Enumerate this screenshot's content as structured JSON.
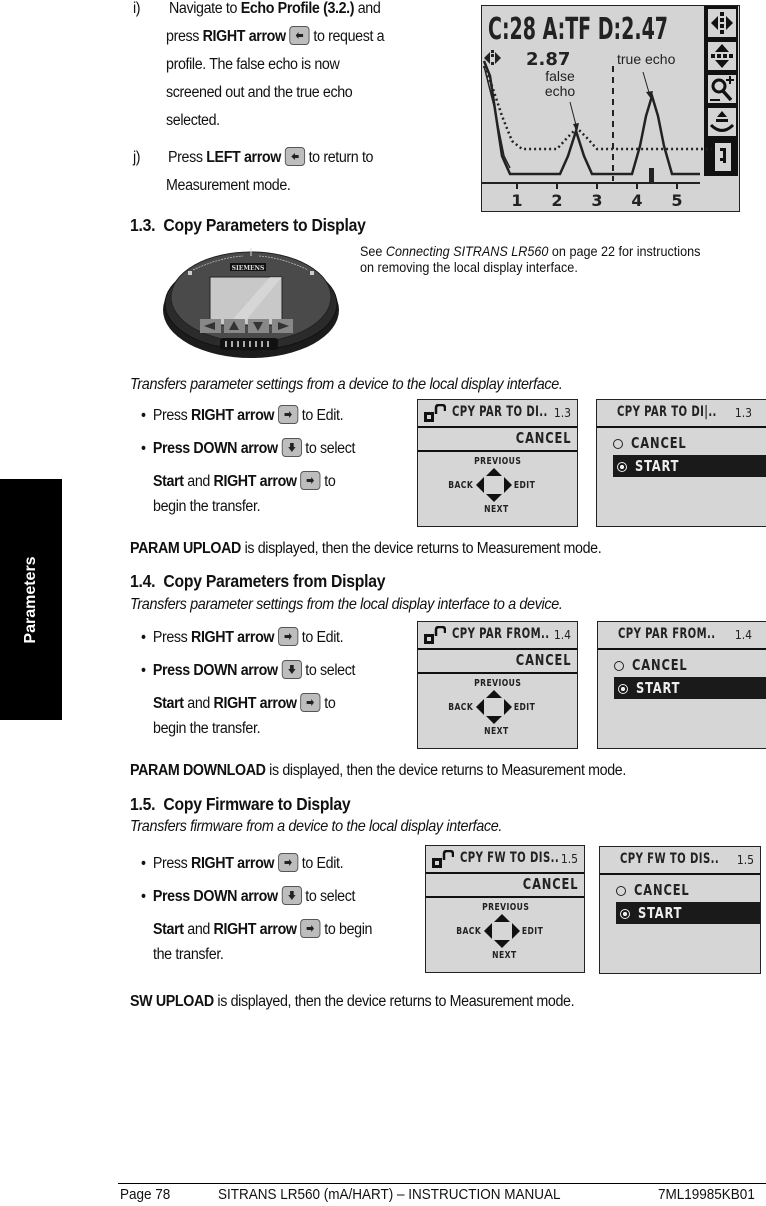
{
  "side_tab": {
    "label": "Parameters"
  },
  "steps": {
    "i": {
      "marker": "i)",
      "line1_pre": "Navigate to ",
      "line1_bold": "Echo Profile (3.2.)",
      "line1_post": " and",
      "line2_pre": "press ",
      "line2_bold": "RIGHT arrow",
      "line2_post": "to request a",
      "line3": "profile. The false echo is now",
      "line4": "screened out and the true echo",
      "line5": "selected."
    },
    "j": {
      "marker": "j)",
      "line1_pre": "Press ",
      "line1_bold": "LEFT arrow",
      "line1_post": "to return to",
      "line2": "Measurement mode."
    }
  },
  "profile_display": {
    "header": "C:28   A:TF D:2.47",
    "cursor_value": "2.87",
    "label_false_echo": "false echo",
    "label_false_line1": "false",
    "label_false_line2": "echo",
    "label_true_echo": "true echo",
    "x_ticks": [
      "1",
      "2",
      "3",
      "4",
      "5"
    ],
    "side_icons": [
      "horizontal-pan-icon",
      "vertical-pan-icon",
      "zoom-in-icon",
      "measure-icon",
      "exit-icon"
    ]
  },
  "sections": [
    {
      "number": "1.3.",
      "title": "Copy Parameters to Display",
      "note_pre": "See ",
      "note_italic": "Connecting SITRANS LR560",
      "note_post_line1": " on page 22 for instructions",
      "note_line2": "on removing the local display interface.",
      "description": "Transfers parameter settings from a device to the local display interface.",
      "bullets": {
        "b1_pre": "Press ",
        "b1_bold": "RIGHT arrow",
        "b1_post": "to Edit.",
        "b2_bold": "Press DOWN arrow",
        "b2_post": "to select",
        "b3_bold1": "Start",
        "b3_mid": " and ",
        "b3_bold2": "RIGHT arrow",
        "b3_post": "to",
        "b4": "begin the transfer."
      },
      "lcd_edit": {
        "title": "CPY PAR TO  DI..",
        "num": "1.3",
        "value": "CANCEL",
        "nav_up": "PREVIOUS",
        "nav_left": "BACK",
        "nav_right": "EDIT",
        "nav_down": "NEXT"
      },
      "lcd_select": {
        "title": "CPY PAR TO DI|..",
        "num": "1.3",
        "options": [
          "CANCEL",
          "START"
        ],
        "selected": "START"
      },
      "result_bold": "PARAM UPLOAD",
      "result_text": " is displayed, then the device returns to Measurement mode."
    },
    {
      "number": "1.4.",
      "title": "Copy Parameters from Display",
      "description": "Transfers parameter settings from the local display interface to a device.",
      "bullets": {
        "b1_pre": "Press ",
        "b1_bold": "RIGHT arrow",
        "b1_post": "to Edit.",
        "b2_bold": "Press DOWN arrow",
        "b2_post": "to select",
        "b3_bold1": "Start",
        "b3_mid": " and ",
        "b3_bold2": "RIGHT arrow",
        "b3_post": "to",
        "b4": "begin the transfer."
      },
      "lcd_edit": {
        "title": "CPY PAR FROM..",
        "num": "1.4",
        "value": "CANCEL",
        "nav_up": "PREVIOUS",
        "nav_left": "BACK",
        "nav_right": "EDIT",
        "nav_down": "NEXT"
      },
      "lcd_select": {
        "title": "CPY PAR FROM..",
        "num": "1.4",
        "options": [
          "CANCEL",
          "START"
        ],
        "selected": "START"
      },
      "result_bold": "PARAM DOWNLOAD",
      "result_text": " is displayed, then the device returns to Measurement mode."
    },
    {
      "number": "1.5.",
      "title": "Copy Firmware to Display",
      "description": "Transfers firmware from a device to the local display interface.",
      "bullets": {
        "b1_pre": "Press ",
        "b1_bold": "RIGHT arrow",
        "b1_post": "to Edit.",
        "b2_bold": "Press DOWN arrow",
        "b2_post": "to select",
        "b3_bold1": "Start",
        "b3_mid": " and ",
        "b3_bold2": "RIGHT arrow",
        "b3_post": "to begin",
        "b4": "the transfer."
      },
      "lcd_edit": {
        "title": "CPY FW TO  DIS..",
        "num": "1.5",
        "value": "CANCEL",
        "nav_up": "PREVIOUS",
        "nav_left": "BACK",
        "nav_right": "EDIT",
        "nav_down": "NEXT"
      },
      "lcd_select": {
        "title": "CPY FW TO DIS..",
        "num": "1.5",
        "options": [
          "CANCEL",
          "START"
        ],
        "selected": "START"
      },
      "result_bold": "SW UPLOAD",
      "result_text": " is displayed, then the device returns to Measurement mode."
    }
  ],
  "device_image": {
    "brand": "SIEMENS"
  },
  "footer": {
    "page": "Page 78",
    "manual": "SITRANS LR560 (mA/HART) – INSTRUCTION MANUAL",
    "doc_id": "7ML19985KB01"
  }
}
